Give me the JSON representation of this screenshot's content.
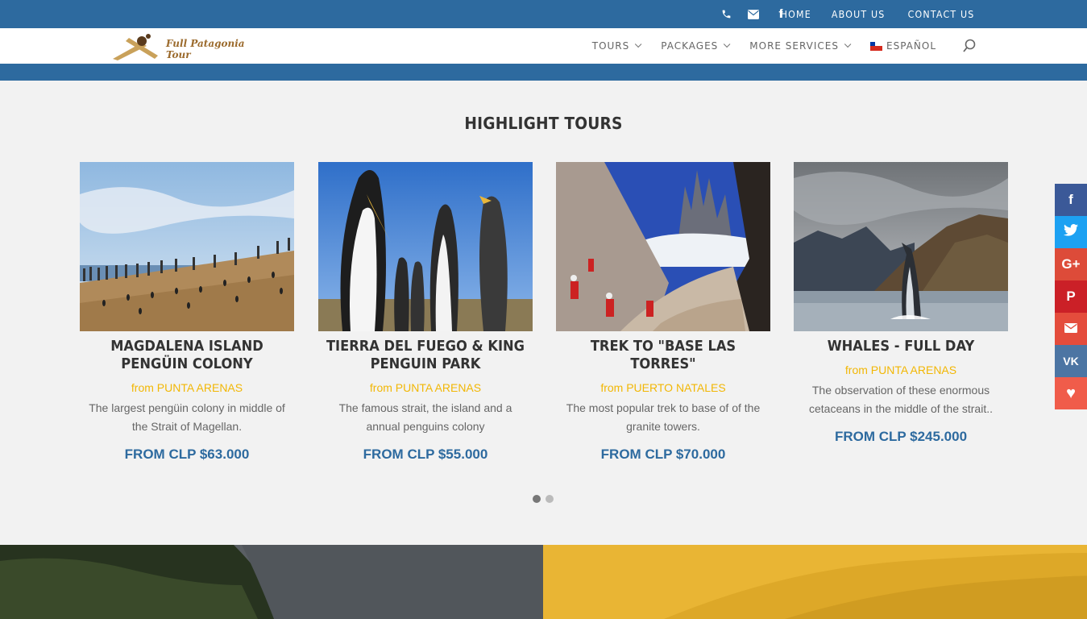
{
  "topbar": {
    "icons": [
      "phone-icon",
      "envelope-icon",
      "facebook-icon"
    ],
    "links": [
      {
        "label": "HOME"
      },
      {
        "label": "ABOUT US"
      },
      {
        "label": "CONTACT US"
      }
    ]
  },
  "nav": {
    "logo_text": "Full Patagonia Tour",
    "items": [
      {
        "label": "TOURS"
      },
      {
        "label": "PACKAGES"
      },
      {
        "label": "MORE SERVICES"
      },
      {
        "label": "ESPAÑOL"
      }
    ]
  },
  "section": {
    "title": "HIGHLIGHT TOURS"
  },
  "tours": [
    {
      "title": "MAGDALENA ISLAND PENGÜIN COLONY",
      "from": "from PUNTA ARENAS",
      "desc": "The largest pengüin colony in middle of the Strait of Magellan.",
      "price": "FROM CLP $63.000"
    },
    {
      "title": "TIERRA DEL FUEGO & KING PENGUIN PARK",
      "from": "from PUNTA ARENAS",
      "desc": "The famous strait, the island and a annual penguins colony",
      "price": "FROM CLP $55.000"
    },
    {
      "title": "TREK TO \"BASE LAS TORRES\"",
      "from": "from PUERTO NATALES",
      "desc": "The most popular trek to base of of the granite towers.",
      "price": "FROM CLP $70.000"
    },
    {
      "title": "WHALES - FULL DAY",
      "from": "from PUNTA ARENAS",
      "desc": "The observation of these enormous cetaceans in the middle of the strait..",
      "price": "FROM CLP $245.000"
    }
  ],
  "slider": {
    "pages": 2,
    "active": 1
  },
  "share": [
    {
      "icon": "facebook-icon",
      "glyph": "f",
      "color": "#3b5998"
    },
    {
      "icon": "twitter-icon",
      "glyph": "🐦",
      "color": "#1da1f2"
    },
    {
      "icon": "google-plus-icon",
      "glyph": "G+",
      "color": "#dd4b39"
    },
    {
      "icon": "pinterest-icon",
      "glyph": "P",
      "color": "#cb2027"
    },
    {
      "icon": "email-icon",
      "glyph": "✉",
      "color": "#e44c3c"
    },
    {
      "icon": "vk-icon",
      "glyph": "VK",
      "color": "#4c75a3"
    },
    {
      "icon": "heart-icon",
      "glyph": "♥",
      "color": "#f05c4a"
    }
  ],
  "colors": {
    "brand_blue": "#2d6a9f",
    "accent_yellow": "#f2b705",
    "background": "#f2f2f2"
  }
}
